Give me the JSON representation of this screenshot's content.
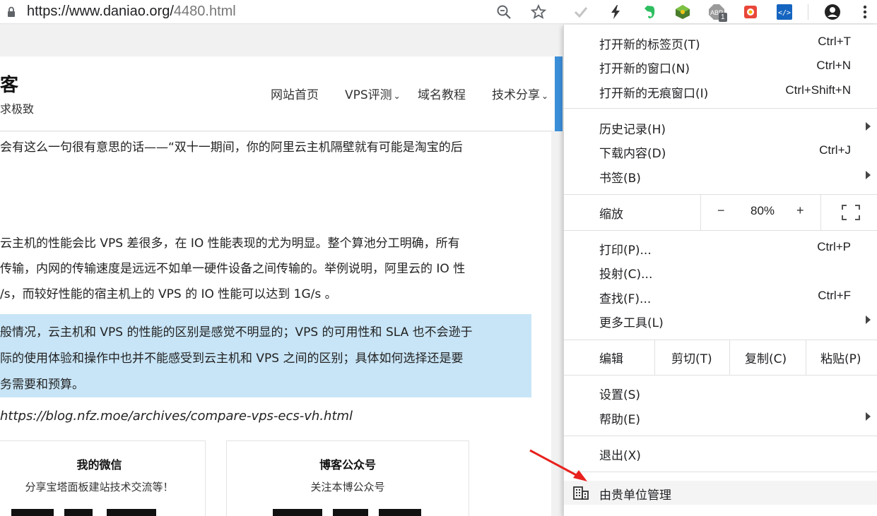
{
  "browser": {
    "url_domain": "https://www.daniao.org/",
    "url_path": "4480.html",
    "extension_badge": "1",
    "icons": [
      "zoom-icon",
      "bookmark-star-icon",
      "checkmark-extension-icon",
      "lightning-extension-icon",
      "evernote-extension-icon",
      "globe-extension-icon",
      "adblock-extension-icon",
      "extension-icon",
      "code-extension-icon",
      "profile-icon",
      "more-menu-icon"
    ]
  },
  "site": {
    "title": "客",
    "slogan": "求极致",
    "nav": [
      "网站首页",
      "VPS评测",
      "域名教程",
      "技术分享"
    ],
    "nav_caret": "⌄"
  },
  "article": {
    "line1": "会有这么一句很有意思的话——“双十一期间，你的阿里云主机隔壁就有可能是淘宝的后",
    "para2": [
      "  云主机的性能会比 VPS 差很多，在 IO 性能表现的尤为明显。整个算池分工明确，所有",
      "传输，内网的传输速度是远远不如单一硬件设备之间传输的。举例说明，阿里云的 IO 性",
      "/s，而较好性能的宿主机上的 VPS 的 IO 性能可以达到 1G/s 。"
    ],
    "quote": [
      "般情况，云主机和 VPS 的性能的区别是感觉不明显的；VPS 的可用性和 SLA 也不会逊于",
      "际的使用体验和操作中也并不能感受到云主机和 VPS 之间的区别；具体如何选择还是要",
      "务需要和预算。"
    ],
    "source": "https://blog.nfz.moe/archives/compare-vps-ecs-vh.html",
    "boxes": [
      {
        "title": "我的微信",
        "desc": "分享宝塔面板建站技术交流等！"
      },
      {
        "title": "博客公众号",
        "desc": "关注本博公众号"
      }
    ]
  },
  "menu": {
    "new_tab": {
      "label": "打开新的标签页(T)",
      "shortcut": "Ctrl+T"
    },
    "new_window": {
      "label": "打开新的窗口(N)",
      "shortcut": "Ctrl+N"
    },
    "incognito": {
      "label": "打开新的无痕窗口(I)",
      "shortcut": "Ctrl+Shift+N"
    },
    "history": {
      "label": "历史记录(H)"
    },
    "downloads": {
      "label": "下载内容(D)",
      "shortcut": "Ctrl+J"
    },
    "bookmarks": {
      "label": "书签(B)"
    },
    "zoom": {
      "label": "缩放",
      "minus": "−",
      "value": "80%",
      "plus": "+"
    },
    "print": {
      "label": "打印(P)...",
      "shortcut": "Ctrl+P"
    },
    "cast": {
      "label": "投射(C)..."
    },
    "find": {
      "label": "查找(F)...",
      "shortcut": "Ctrl+F"
    },
    "more_tools": {
      "label": "更多工具(L)"
    },
    "edit": {
      "label": "编辑",
      "cut": "剪切(T)",
      "copy": "复制(C)",
      "paste": "粘贴(P)"
    },
    "settings": {
      "label": "设置(S)"
    },
    "help": {
      "label": "帮助(E)"
    },
    "exit": {
      "label": "退出(X)"
    },
    "managed": {
      "label": "由贵单位管理"
    }
  },
  "colors": {
    "accent_strip": "#3b8fd9",
    "quote_bg": "#c8e5f7",
    "annotation_arrow": "#e8211d"
  }
}
